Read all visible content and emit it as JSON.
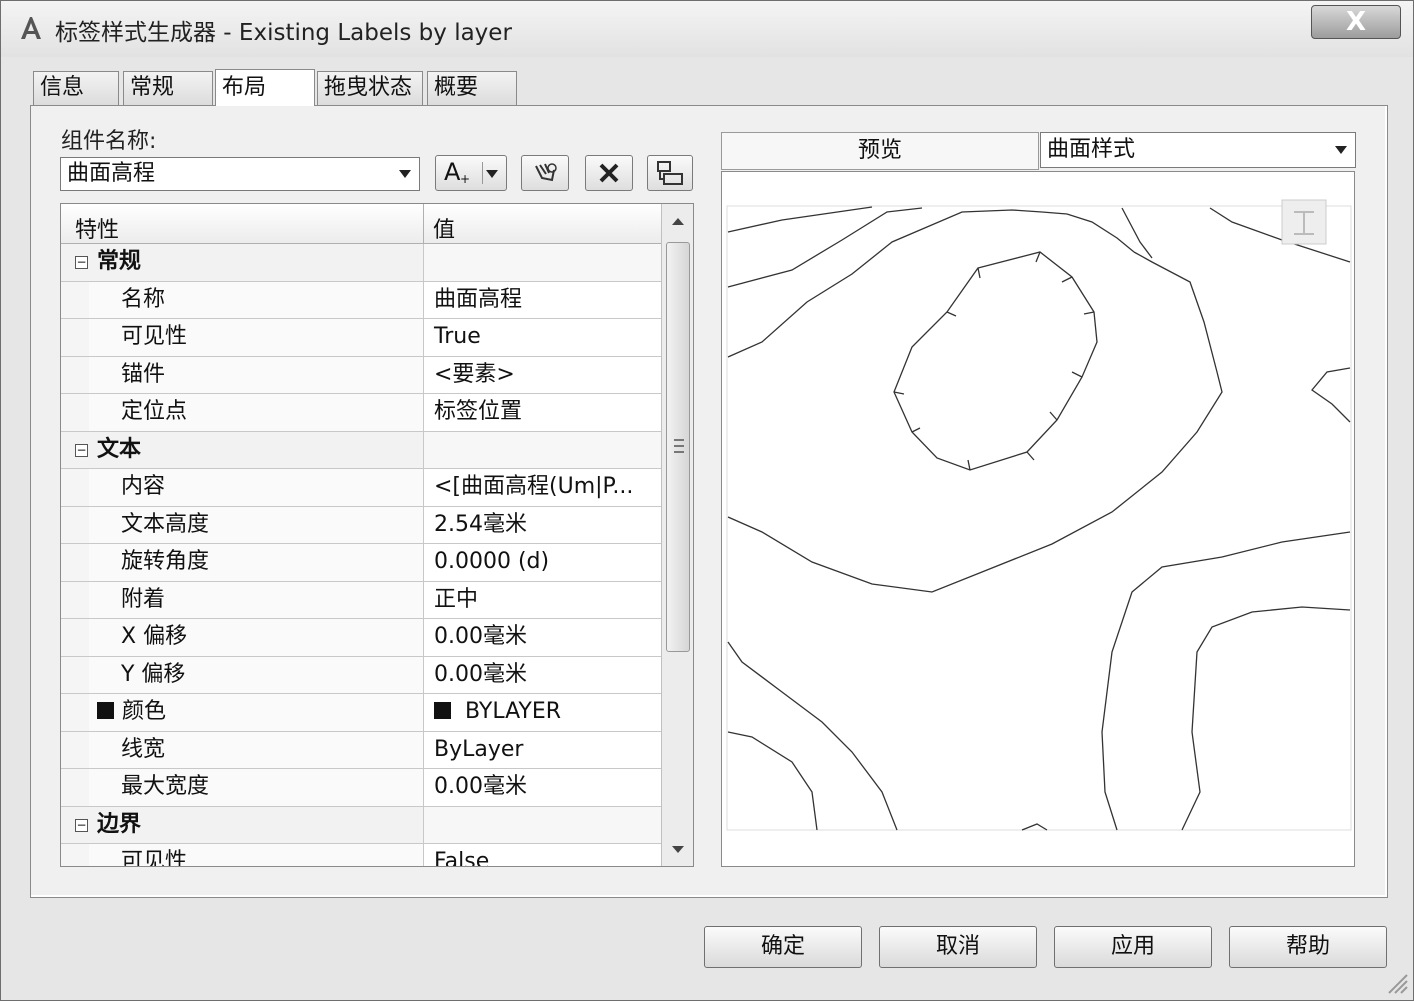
{
  "window": {
    "title": "标签样式生成器 - Existing Labels by layer",
    "close_label": "X"
  },
  "tabs": [
    {
      "label": "信息"
    },
    {
      "label": "常规"
    },
    {
      "label": "布局",
      "active": true
    },
    {
      "label": "拖曳状态"
    },
    {
      "label": "概要"
    }
  ],
  "component": {
    "label": "组件名称:",
    "selected": "曲面高程",
    "text_button_glyph": "A"
  },
  "grid": {
    "col_property": "特性",
    "col_value": "值",
    "rows": [
      {
        "type": "group",
        "name": "常规"
      },
      {
        "name": "名称",
        "value": "曲面高程"
      },
      {
        "name": "可见性",
        "value": "True"
      },
      {
        "name": "锚件",
        "value": "<要素>"
      },
      {
        "name": "定位点",
        "value": "标签位置"
      },
      {
        "type": "group",
        "name": "文本"
      },
      {
        "name": "内容",
        "value": "<[曲面高程(Um|P..."
      },
      {
        "name": "文本高度",
        "value": "2.54毫米"
      },
      {
        "name": "旋转角度",
        "value": "0.0000 (d)"
      },
      {
        "name": "附着",
        "value": "正中"
      },
      {
        "name": "X 偏移",
        "value": "0.00毫米"
      },
      {
        "name": "Y 偏移",
        "value": "0.00毫米"
      },
      {
        "name": "颜色",
        "value": "BYLAYER",
        "swatch": "#111111"
      },
      {
        "name": "线宽",
        "value": "ByLayer"
      },
      {
        "name": "最大宽度",
        "value": "0.00毫米"
      },
      {
        "type": "group",
        "name": "边界"
      },
      {
        "name": "可见性",
        "value": "False"
      }
    ]
  },
  "preview": {
    "label": "预览",
    "style_selected": "曲面样式"
  },
  "buttons": {
    "ok": "确定",
    "cancel": "取消",
    "apply": "应用",
    "help": "帮助"
  },
  "colors": {
    "window_bg": "#e6e6e6",
    "panel_bg": "#f0f0f0",
    "contour_line": "#333333"
  }
}
